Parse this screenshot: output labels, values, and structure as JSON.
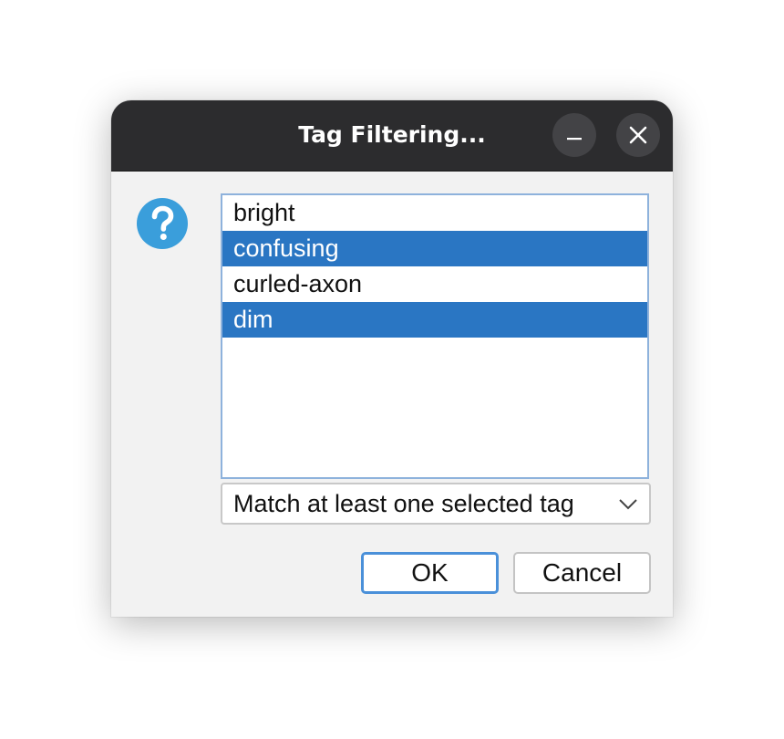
{
  "window": {
    "title": "Tag Filtering...",
    "icons": {
      "minimize": "minimize-icon",
      "close": "close-icon",
      "dialog": "question-icon"
    }
  },
  "tags": {
    "items": [
      {
        "label": "bright",
        "selected": false
      },
      {
        "label": "confusing",
        "selected": true
      },
      {
        "label": "curled-axon",
        "selected": false
      },
      {
        "label": "dim",
        "selected": true
      }
    ]
  },
  "match_mode": {
    "selected": "Match at least one selected tag"
  },
  "buttons": {
    "ok": "OK",
    "cancel": "Cancel"
  },
  "colors": {
    "titlebar": "#2c2c2e",
    "selection": "#2a76c3",
    "icon": "#3a9edb",
    "focus": "#4a90d9"
  }
}
